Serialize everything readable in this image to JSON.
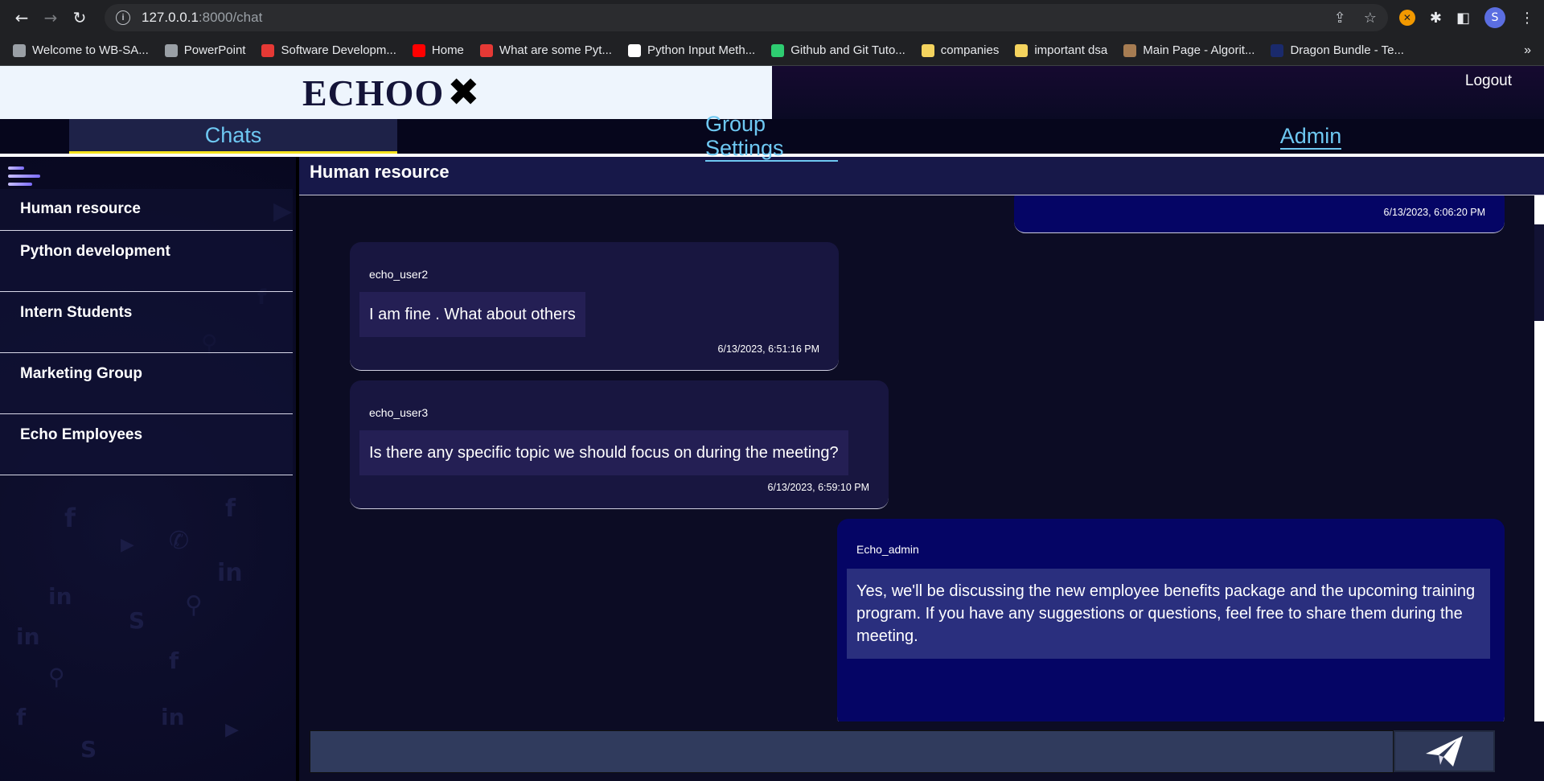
{
  "browser": {
    "url_host": "127.0.0.1",
    "url_path": ":8000/chat",
    "profile_initial": "S",
    "bookmarks": [
      {
        "label": "Welcome to WB-SA...",
        "color": "#9aa0a6"
      },
      {
        "label": "PowerPoint",
        "color": "#9aa0a6"
      },
      {
        "label": "Software Developm...",
        "color": "#e53935"
      },
      {
        "label": "Home",
        "color": "#ff0000"
      },
      {
        "label": "What are some Pyt...",
        "color": "#e53935"
      },
      {
        "label": "Python Input Meth...",
        "color": "#ffffff"
      },
      {
        "label": "Github and Git Tuto...",
        "color": "#2ecc71"
      },
      {
        "label": "companies",
        "color": "#f4d35e"
      },
      {
        "label": "important dsa",
        "color": "#f4d35e"
      },
      {
        "label": "Main Page - Algorit...",
        "color": "#a67c52"
      },
      {
        "label": "Dragon Bundle - Te...",
        "color": "#1a2a6c"
      }
    ],
    "more": "»"
  },
  "app": {
    "logo": "ECHOO",
    "logo_mark": "✖",
    "logout": "Logout",
    "tabs": [
      "Chats",
      "Group Settings",
      "Admin"
    ]
  },
  "groups": [
    "Human resource",
    "Python development",
    "Intern Students",
    "Marketing Group",
    "Echo Employees"
  ],
  "chat": {
    "title": "Human resource",
    "messages": [
      {
        "user": "",
        "text": "",
        "time": "6/13/2023, 6:06:20 PM",
        "mine": true
      },
      {
        "user": "echo_user2",
        "text": "I am fine . What about others",
        "time": "6/13/2023, 6:51:16 PM",
        "mine": false
      },
      {
        "user": "echo_user3",
        "text": "Is there any specific topic we should focus on during the meeting?",
        "time": "6/13/2023, 6:59:10 PM",
        "mine": false
      },
      {
        "user": "Echo_admin",
        "text": "Yes, we'll be discussing the new employee benefits package and the upcoming training program. If you have any suggestions or questions, feel free to share them during the meeting.",
        "time": "",
        "mine": true
      }
    ],
    "input_placeholder": ""
  },
  "colors": {
    "accent": "#6ec8f2",
    "active_tab_underline": "#f5e21d",
    "own_message": "#050565",
    "other_message": "#181640"
  }
}
